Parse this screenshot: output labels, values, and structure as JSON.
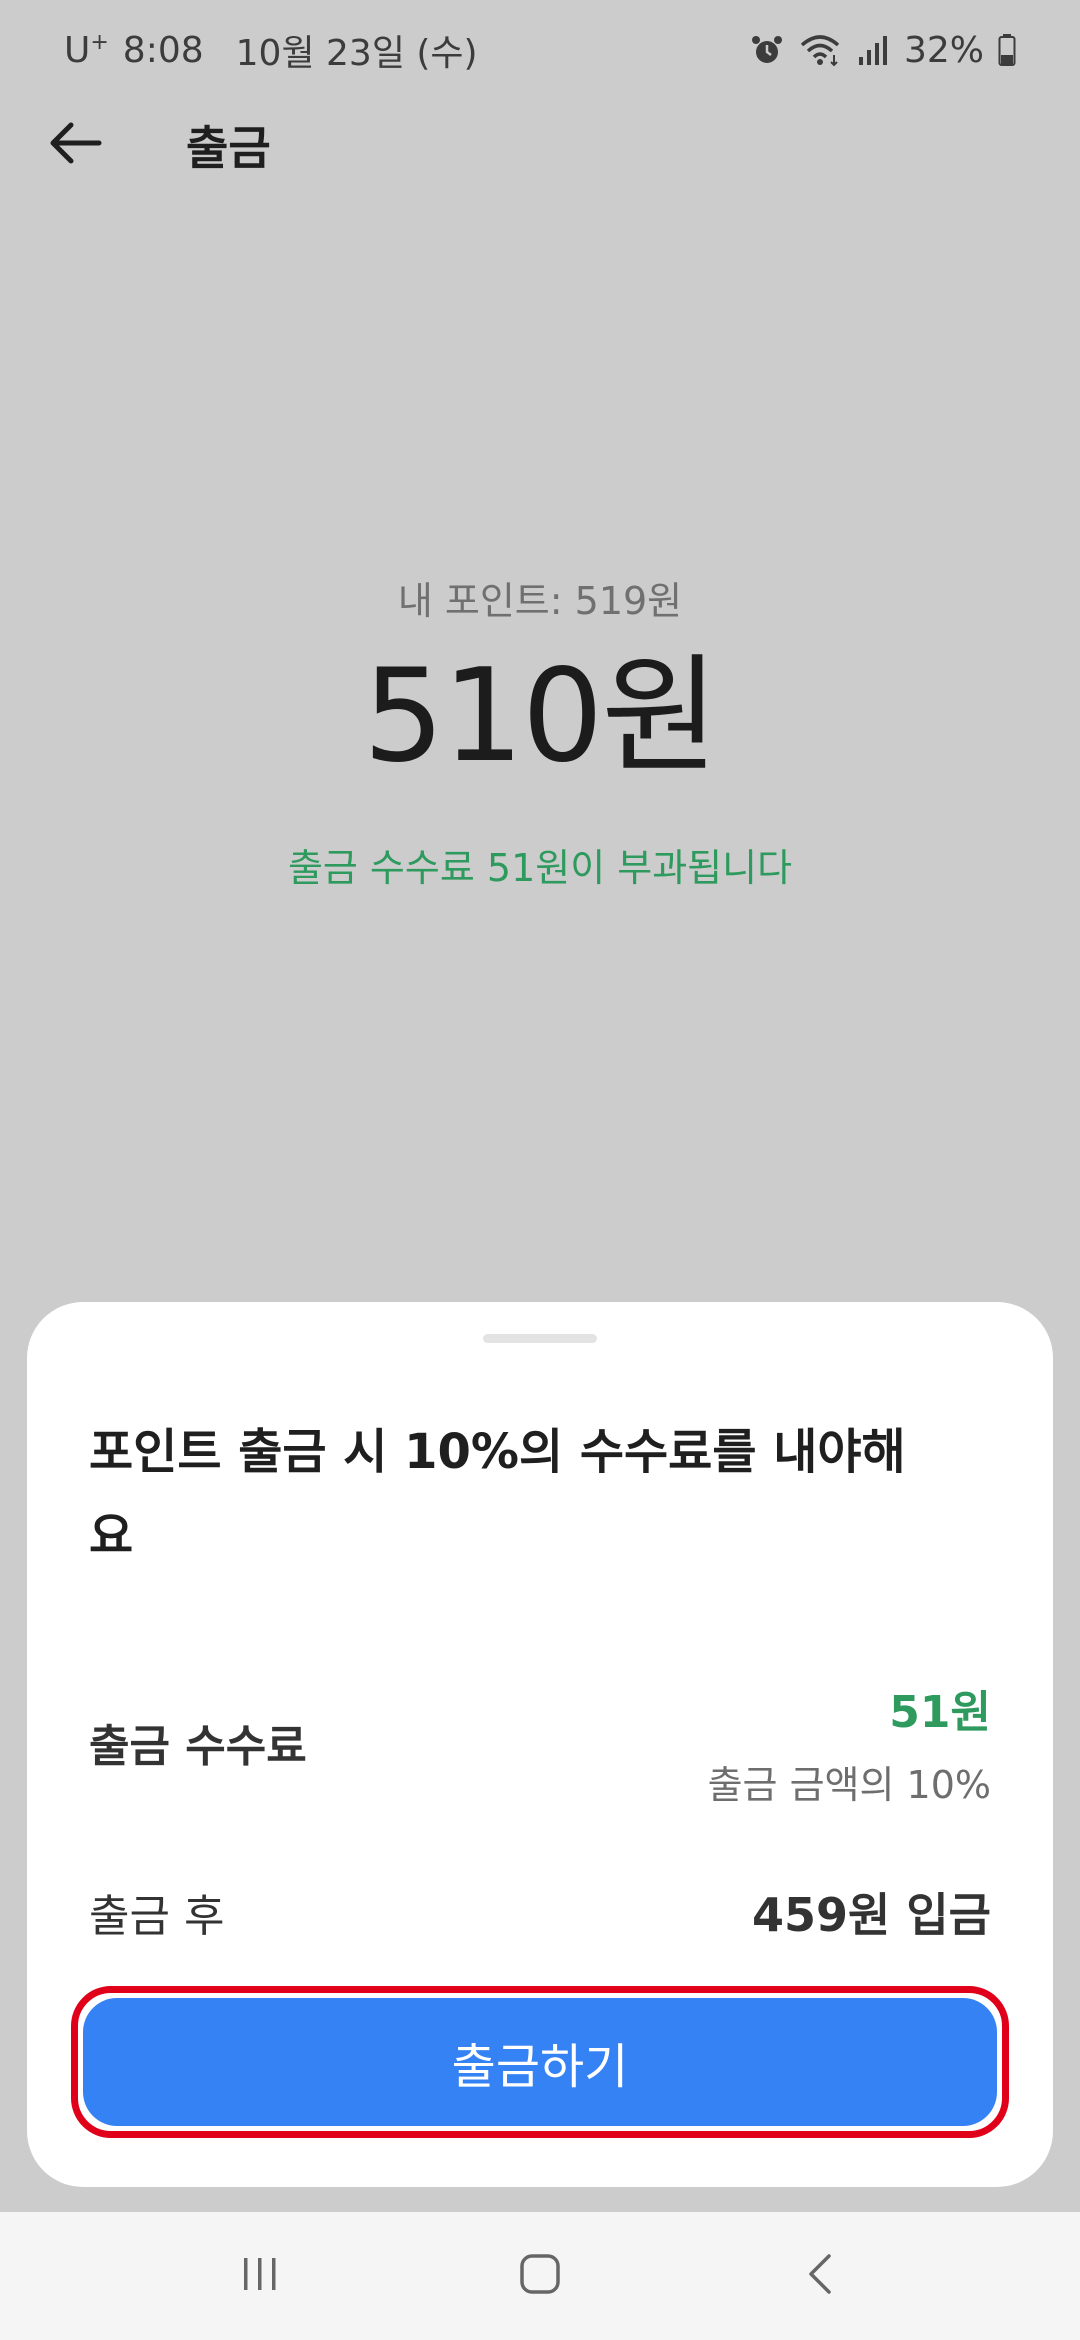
{
  "status_bar": {
    "carrier": "U",
    "carrier_sup": "+",
    "time": "8:08",
    "date": "10월 23일 (수)",
    "battery": "32%",
    "icons": [
      "alarm-icon",
      "wifi-icon",
      "signal-icon",
      "battery-icon"
    ]
  },
  "header": {
    "title": "출금",
    "back_icon": "back-arrow-icon"
  },
  "amount": {
    "points_label": "내 포인트: 519원",
    "value": "510원",
    "fee_notice": "출금 수수료 51원이 부과됩니다"
  },
  "sheet": {
    "title": "포인트 출금 시 10%의 수수료를 내야해요",
    "fee_label": "출금 수수료",
    "fee_amount": "51원",
    "fee_sub": "출금 금액의 10%",
    "after_label": "출금 후",
    "after_value": "459원 입금",
    "button_label": "출금하기"
  },
  "nav": {
    "icons": [
      "recent-apps-icon",
      "home-icon",
      "back-icon"
    ]
  },
  "colors": {
    "accent_green": "#2e9a5e",
    "button_blue": "#3582f5",
    "highlight_red": "#e0001a"
  }
}
